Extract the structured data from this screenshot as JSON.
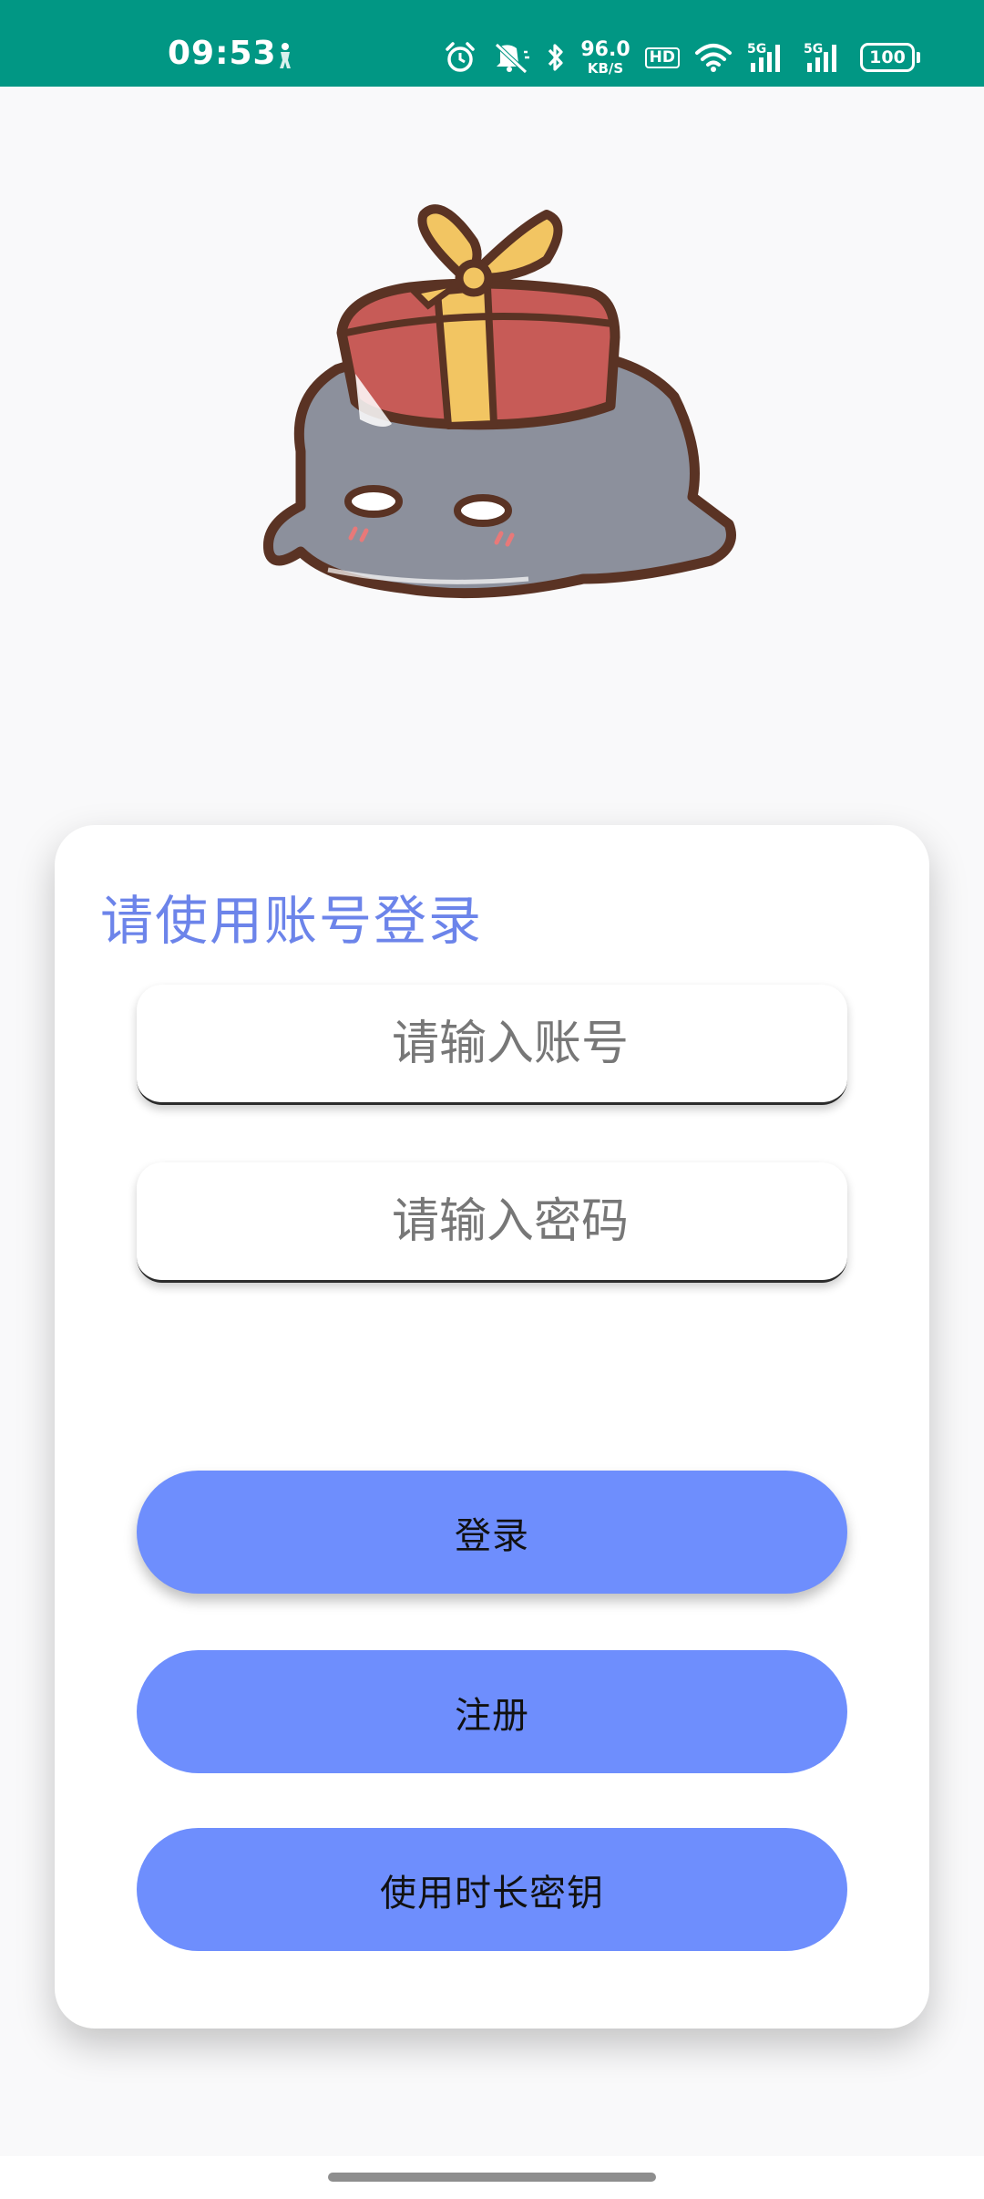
{
  "status_bar": {
    "time": "09:53",
    "net_speed_value": "96.0",
    "net_speed_unit": "KB/S",
    "hd_label": "HD",
    "signal_1_label": "5G",
    "signal_2_label": "5G",
    "battery_level": "100",
    "icons": [
      "alarm-icon",
      "mute-icon",
      "bluetooth-icon",
      "hd-icon",
      "wifi-icon",
      "signal-5g-icon",
      "signal-5g-icon",
      "battery-icon"
    ]
  },
  "login": {
    "title": "请使用账号登录",
    "account_placeholder": "请输入账号",
    "password_placeholder": "请输入密码",
    "login_label": "登录",
    "register_label": "注册",
    "key_label": "使用时长密钥"
  },
  "colors": {
    "status_bar": "#019784",
    "accent": "#6e8efd",
    "title": "#6c84ea",
    "background": "#f9f9fa"
  }
}
